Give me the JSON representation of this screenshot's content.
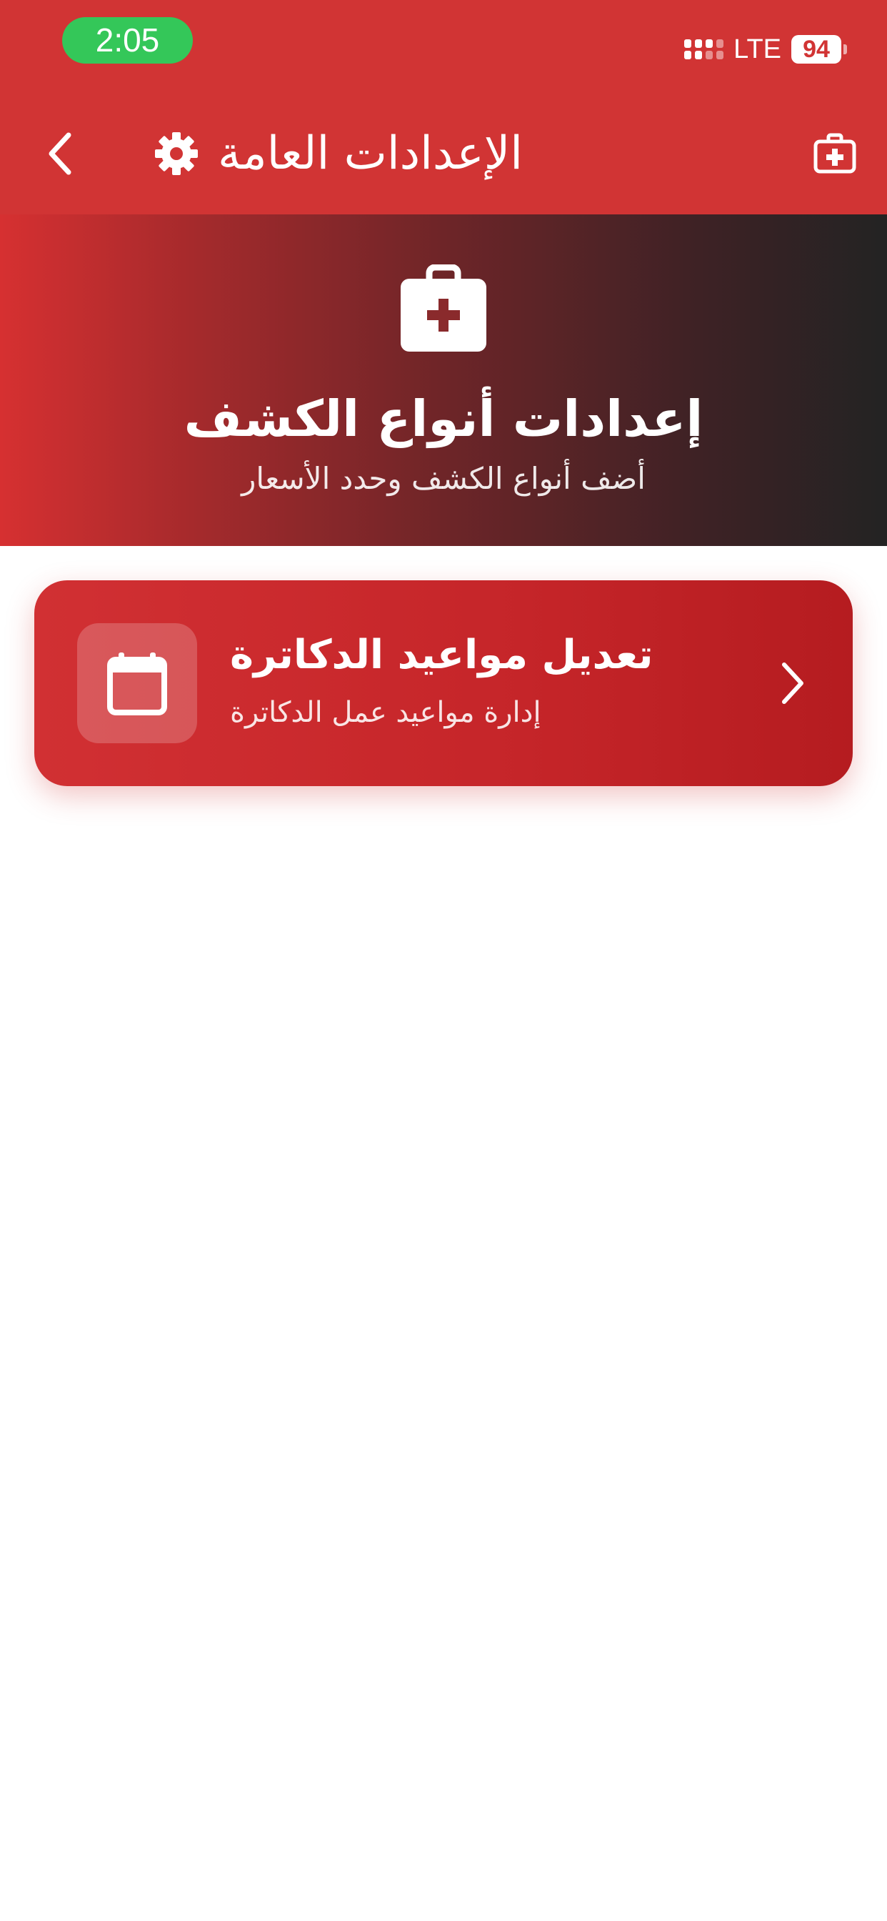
{
  "status_bar": {
    "time": "2:05",
    "network": "LTE",
    "battery": "94"
  },
  "header": {
    "title": "الإعدادات العامة",
    "back_icon": "chevron-left-icon",
    "settings_icon": "gear-icon",
    "action_icon": "medical-kit-icon"
  },
  "hero": {
    "icon": "medical-kit-icon",
    "title": "إعدادات أنواع الكشف",
    "subtitle": "أضف أنواع الكشف وحدد الأسعار"
  },
  "cards": [
    {
      "icon": "calendar-icon",
      "title": "تعديل مواعيد الدكاترة",
      "subtitle": "إدارة مواعيد عمل الدكاترة",
      "chevron_icon": "chevron-right-icon"
    }
  ],
  "colors": {
    "primary": "#d13434",
    "status_green": "#34c759",
    "hero_start": "#d63031",
    "hero_end": "#232323",
    "background": "#ffffff"
  }
}
